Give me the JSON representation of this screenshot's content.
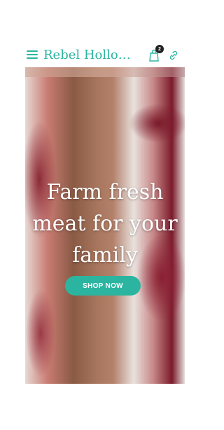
{
  "header": {
    "title": "Rebel Hollow F...",
    "cart_count": "2",
    "menu_icon": "hamburger-icon",
    "cart_icon": "shopping-bag-icon",
    "link_icon": "link-icon"
  },
  "hero": {
    "headline": "Farm fresh meat for your family",
    "cta_label": "SHOP NOW"
  },
  "colors": {
    "accent": "#2bb5a0",
    "badge": "#222222",
    "headline_text": "#ffffff"
  }
}
